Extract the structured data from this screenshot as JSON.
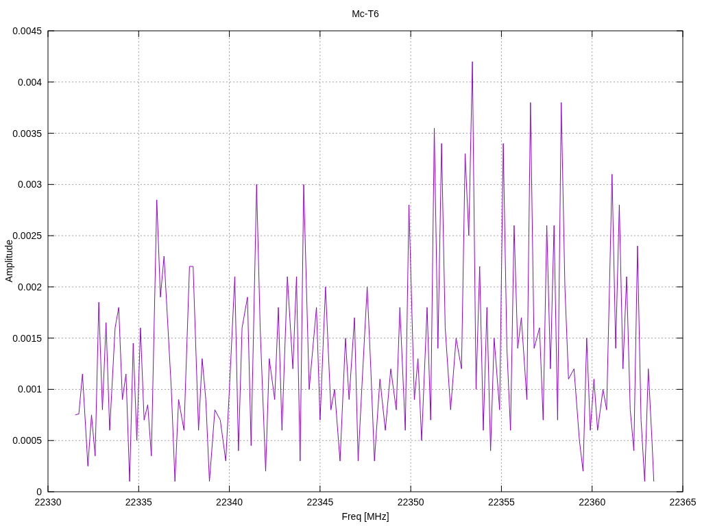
{
  "chart_data": {
    "type": "line",
    "title": "Mc-T6",
    "xlabel": "Freq [MHz]",
    "ylabel": "Amplitude",
    "x": [
      22331.5,
      22331.7,
      22331.9,
      22332.2,
      22332.4,
      22332.6,
      22332.8,
      22333.0,
      22333.2,
      22333.4,
      22333.7,
      22333.9,
      22334.1,
      22334.3,
      22334.5,
      22334.7,
      22334.9,
      22335.1,
      22335.3,
      22335.5,
      22335.7,
      22336.0,
      22336.2,
      22336.4,
      22336.8,
      22337.0,
      22337.2,
      22337.5,
      22337.8,
      22338.0,
      22338.3,
      22338.5,
      22338.7,
      22338.9,
      22339.2,
      22339.5,
      22339.8,
      22340.0,
      22340.3,
      22340.5,
      22340.7,
      22341.0,
      22341.2,
      22341.5,
      22341.7,
      22342.0,
      22342.2,
      22342.5,
      22342.7,
      22342.9,
      22343.2,
      22343.5,
      22343.7,
      22343.9,
      22344.1,
      22344.4,
      22344.8,
      22345.0,
      22345.3,
      22345.6,
      22345.8,
      22346.1,
      22346.4,
      22346.6,
      22346.9,
      22347.1,
      22347.3,
      22347.6,
      22347.8,
      22348.0,
      22348.3,
      22348.6,
      22348.9,
      22349.2,
      22349.4,
      22349.7,
      22349.9,
      22350.2,
      22350.4,
      22350.6,
      22350.9,
      22351.1,
      22351.3,
      22351.5,
      22351.7,
      22351.9,
      22352.2,
      22352.5,
      22352.8,
      22353.0,
      22353.2,
      22353.4,
      22353.6,
      22353.8,
      22354.0,
      22354.2,
      22354.4,
      22354.6,
      22354.9,
      22355.1,
      22355.3,
      22355.5,
      22355.7,
      22355.9,
      22356.1,
      22356.4,
      22356.6,
      22356.8,
      22357.1,
      22357.3,
      22357.5,
      22357.7,
      22357.9,
      22358.1,
      22358.3,
      22358.5,
      22358.7,
      22359.0,
      22359.3,
      22359.5,
      22359.7,
      22359.9,
      22360.1,
      22360.3,
      22360.6,
      22360.8,
      22361.1,
      22361.3,
      22361.5,
      22361.7,
      22361.9,
      22362.1,
      22362.3,
      22362.5,
      22362.7,
      22362.9,
      22363.1,
      22363.3,
      22363.4
    ],
    "grid": true,
    "series": [
      {
        "color": "#9400d3",
        "values": [
          0.00075,
          0.00076,
          0.00115,
          0.00025,
          0.00075,
          0.00035,
          0.00185,
          0.0008,
          0.00165,
          0.0006,
          0.0016,
          0.0018,
          0.0009,
          0.00115,
          0.0001,
          0.00145,
          0.0005,
          0.0016,
          0.0007,
          0.00085,
          0.00035,
          0.00285,
          0.0019,
          0.0023,
          0.001,
          0.0001,
          0.0009,
          0.0006,
          0.0022,
          0.0022,
          0.0006,
          0.0013,
          0.0009,
          0.0001,
          0.0008,
          0.0007,
          0.0003,
          0.001,
          0.0021,
          0.0004,
          0.0016,
          0.0019,
          0.00045,
          0.003,
          0.0016,
          0.0002,
          0.0013,
          0.0009,
          0.0018,
          0.0006,
          0.0021,
          0.0012,
          0.0021,
          0.0003,
          0.003,
          0.001,
          0.0018,
          0.0007,
          0.002,
          0.0008,
          0.001,
          0.0003,
          0.0015,
          0.0009,
          0.0017,
          0.0003,
          0.001,
          0.002,
          0.0012,
          0.0003,
          0.0011,
          0.0006,
          0.0012,
          0.0008,
          0.0018,
          0.0006,
          0.0028,
          0.0009,
          0.0013,
          0.0005,
          0.0018,
          0.0007,
          0.00355,
          0.0014,
          0.0034,
          0.0016,
          0.0008,
          0.0015,
          0.0012,
          0.0033,
          0.0025,
          0.0042,
          0.001,
          0.0022,
          0.0006,
          0.0018,
          0.0004,
          0.0015,
          0.0008,
          0.0034,
          0.0014,
          0.0006,
          0.0026,
          0.0014,
          0.0017,
          0.0009,
          0.0038,
          0.0014,
          0.0016,
          0.0007,
          0.0026,
          0.0012,
          0.0026,
          0.0007,
          0.0038,
          0.002,
          0.0011,
          0.0012,
          0.0005,
          0.0002,
          0.0015,
          0.0006,
          0.0011,
          0.0006,
          0.001,
          0.0008,
          0.0031,
          0.0014,
          0.0028,
          0.0012,
          0.0021,
          0.0008,
          0.0004,
          0.0024,
          0.0007,
          0.0001,
          0.0012,
          0.0005,
          0.0001
        ]
      }
    ],
    "xlim": [
      22330,
      22365
    ],
    "ylim": [
      0,
      0.0045
    ],
    "xticks": [
      22330,
      22335,
      22340,
      22345,
      22350,
      22355,
      22360,
      22365
    ],
    "yticks": [
      {
        "value": 0,
        "label": "0"
      },
      {
        "value": 0.0005,
        "label": "0.0005"
      },
      {
        "value": 0.001,
        "label": "0.001"
      },
      {
        "value": 0.0015,
        "label": "0.0015"
      },
      {
        "value": 0.002,
        "label": "0.002"
      },
      {
        "value": 0.0025,
        "label": "0.0025"
      },
      {
        "value": 0.003,
        "label": "0.003"
      },
      {
        "value": 0.0035,
        "label": "0.0035"
      },
      {
        "value": 0.004,
        "label": "0.004"
      },
      {
        "value": 0.0045,
        "label": "0.0045"
      }
    ]
  }
}
